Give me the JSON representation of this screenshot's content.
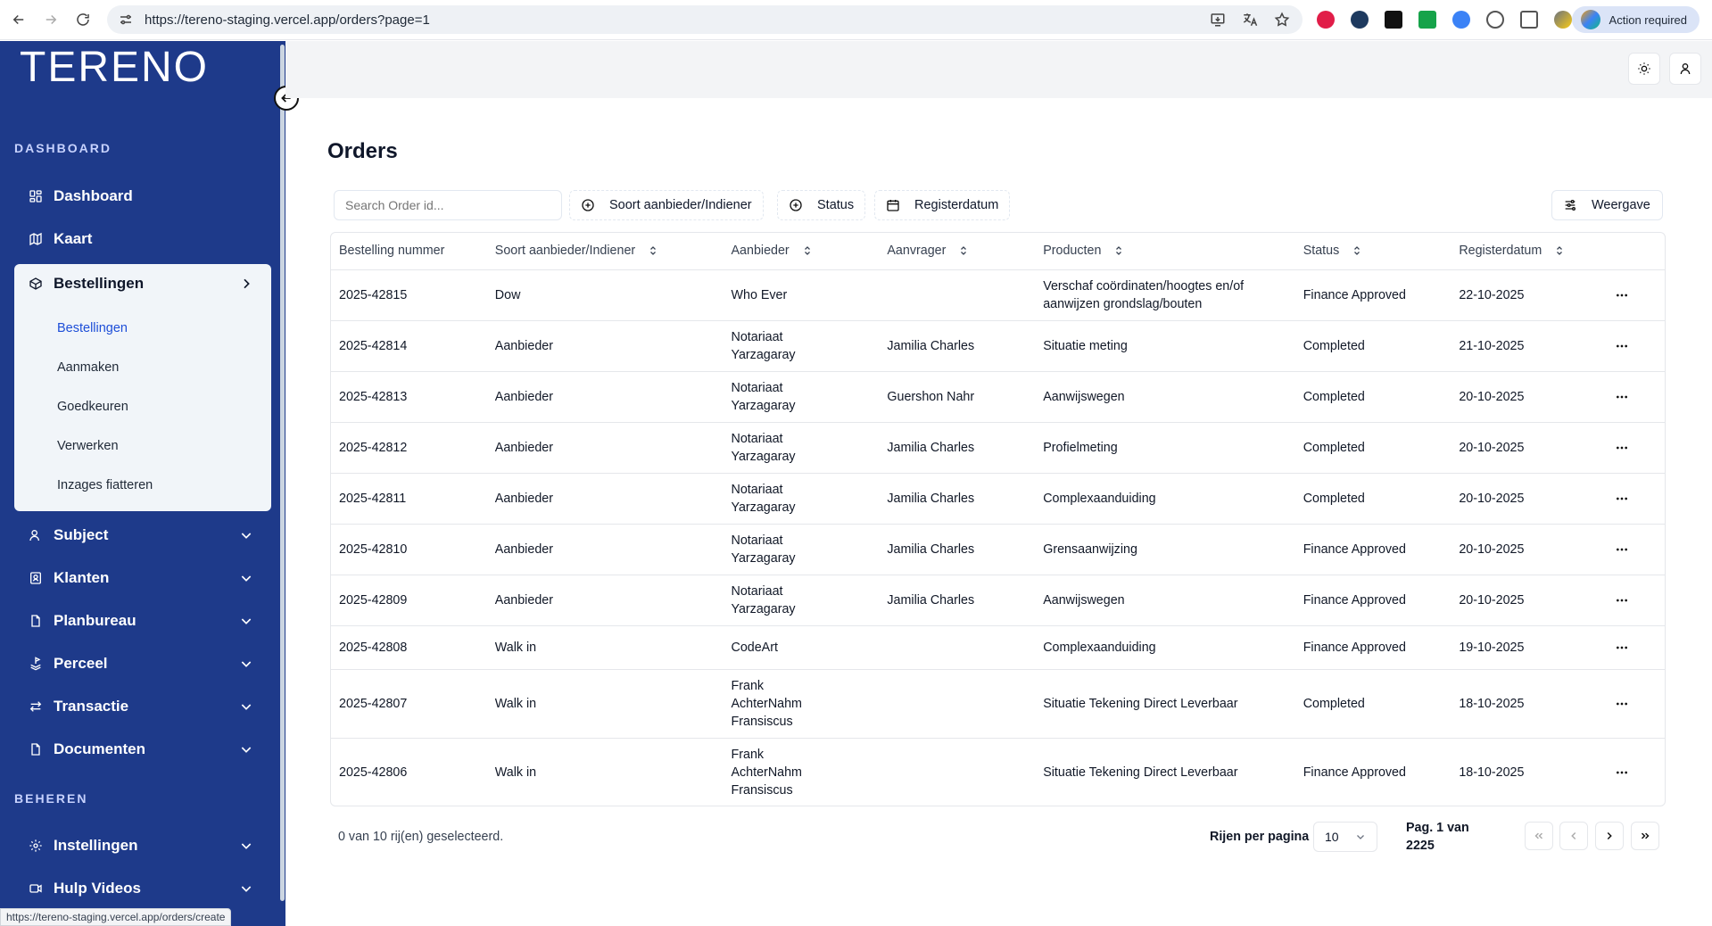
{
  "browser": {
    "url": "https://tereno-staging.vercel.app/orders?page=1",
    "action_label": "Action required",
    "status_url": "https://tereno-staging.vercel.app/orders/create"
  },
  "sidebar": {
    "logo": "TERENO",
    "section_dashboard": "DASHBOARD",
    "section_beheren": "BEHEREN",
    "items": {
      "dashboard": "Dashboard",
      "kaart": "Kaart",
      "bestellingen": "Bestellingen",
      "subject": "Subject",
      "klanten": "Klanten",
      "planbureau": "Planbureau",
      "perceel": "Perceel",
      "transactie": "Transactie",
      "documenten": "Documenten",
      "instellingen": "Instellingen",
      "hulp_videos": "Hulp Videos"
    },
    "sub_items": {
      "bestellingen": "Bestellingen",
      "aanmaken": "Aanmaken",
      "goedkeuren": "Goedkeuren",
      "verwerken": "Verwerken",
      "inzages": "Inzages fiatteren"
    }
  },
  "main": {
    "title": "Orders",
    "search_placeholder": "Search Order id...",
    "filters": {
      "soort": "Soort aanbieder/Indiener",
      "status": "Status",
      "registerdatum": "Registerdatum"
    },
    "view_label": "Weergave",
    "columns": [
      "Bestelling nummer",
      "Soort aanbieder/Indiener",
      "Aanbieder",
      "Aanvrager",
      "Producten",
      "Status",
      "Registerdatum"
    ],
    "rows": [
      {
        "nummer": "2025-42815",
        "soort": "Dow",
        "aanbieder": "Who Ever",
        "aanvrager": "",
        "product": "Verschaf coördinaten/hoogtes en/of aanwijzen grondslag/bouten",
        "status": "Finance Approved",
        "datum": "22-10-2025"
      },
      {
        "nummer": "2025-42814",
        "soort": "Aanbieder",
        "aanbieder": "Notariaat Yarzagaray",
        "aanvrager": "Jamilia Charles",
        "product": "Situatie meting",
        "status": "Completed",
        "datum": "21-10-2025"
      },
      {
        "nummer": "2025-42813",
        "soort": "Aanbieder",
        "aanbieder": "Notariaat Yarzagaray",
        "aanvrager": "Guershon Nahr",
        "product": "Aanwijswegen",
        "status": "Completed",
        "datum": "20-10-2025"
      },
      {
        "nummer": "2025-42812",
        "soort": "Aanbieder",
        "aanbieder": "Notariaat Yarzagaray",
        "aanvrager": "Jamilia Charles",
        "product": "Profielmeting",
        "status": "Completed",
        "datum": "20-10-2025"
      },
      {
        "nummer": "2025-42811",
        "soort": "Aanbieder",
        "aanbieder": "Notariaat Yarzagaray",
        "aanvrager": "Jamilia Charles",
        "product": "Complexaanduiding",
        "status": "Completed",
        "datum": "20-10-2025"
      },
      {
        "nummer": "2025-42810",
        "soort": "Aanbieder",
        "aanbieder": "Notariaat Yarzagaray",
        "aanvrager": "Jamilia Charles",
        "product": "Grensaanwijzing",
        "status": "Finance Approved",
        "datum": "20-10-2025"
      },
      {
        "nummer": "2025-42809",
        "soort": "Aanbieder",
        "aanbieder": "Notariaat Yarzagaray",
        "aanvrager": "Jamilia Charles",
        "product": "Aanwijswegen",
        "status": "Finance Approved",
        "datum": "20-10-2025"
      },
      {
        "nummer": "2025-42808",
        "soort": "Walk in",
        "aanbieder": "CodeArt",
        "aanvrager": "",
        "product": "Complexaanduiding",
        "status": "Finance Approved",
        "datum": "19-10-2025"
      },
      {
        "nummer": "2025-42807",
        "soort": "Walk in",
        "aanbieder": "Frank AchterNahm Fransiscus",
        "aanvrager": "",
        "product": "Situatie Tekening Direct Leverbaar",
        "status": "Completed",
        "datum": "18-10-2025"
      },
      {
        "nummer": "2025-42806",
        "soort": "Walk in",
        "aanbieder": "Frank AchterNahm Fransiscus",
        "aanvrager": "",
        "product": "Situatie Tekening Direct Leverbaar",
        "status": "Finance Approved",
        "datum": "18-10-2025"
      }
    ],
    "selection_text": "0 van 10 rij(en) geselecteerd.",
    "rows_per_page_label": "Rijen per pagina",
    "rows_per_page_value": "10",
    "page_info": "Pag. 1 van 2225"
  }
}
